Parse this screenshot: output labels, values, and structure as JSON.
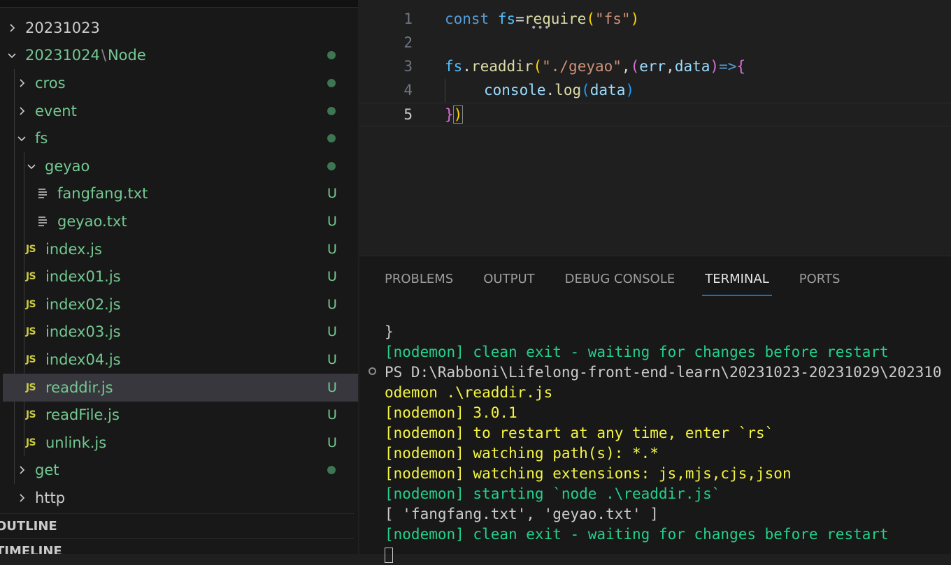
{
  "explorer": {
    "items": [
      {
        "label": "20231023",
        "status": ""
      },
      {
        "label": "20231024",
        "label_suffix": "Node",
        "status": "dot"
      },
      {
        "label": "cros",
        "status": "dot"
      },
      {
        "label": "event",
        "status": "dot"
      },
      {
        "label": "fs",
        "status": "dot"
      },
      {
        "label": "geyao",
        "status": "dot"
      },
      {
        "label": "fangfang.txt",
        "status": "U"
      },
      {
        "label": "geyao.txt",
        "status": "U"
      },
      {
        "label": "index.js",
        "status": "U"
      },
      {
        "label": "index01.js",
        "status": "U"
      },
      {
        "label": "index02.js",
        "status": "U"
      },
      {
        "label": "index03.js",
        "status": "U"
      },
      {
        "label": "index04.js",
        "status": "U"
      },
      {
        "label": "readdir.js",
        "status": "U"
      },
      {
        "label": "readFile.js",
        "status": "U"
      },
      {
        "label": "unlink.js",
        "status": "U"
      },
      {
        "label": "get",
        "status": "dot"
      },
      {
        "label": "http",
        "status": ""
      }
    ],
    "path_separator": "\\",
    "js_badge": "JS",
    "sections": {
      "outline": "OUTLINE",
      "timeline": "TIMELINE"
    }
  },
  "editor": {
    "line_numbers": [
      "1",
      "2",
      "3",
      "4",
      "5"
    ],
    "lines": {
      "l1": {
        "a": "const",
        "b": "fs",
        "c": "=",
        "d": "require",
        "e": "(",
        "f": "\"fs\"",
        "g": ")"
      },
      "l3": {
        "a": "fs",
        "b": ".",
        "c": "readdir",
        "d": "(",
        "e": "\"./geyao\"",
        "f": ",",
        "g": "(",
        "h": "err",
        "i": ",",
        "j": "data",
        "k": ")",
        "l": "=>",
        "m": "{"
      },
      "l4": {
        "a": "console",
        "b": ".",
        "c": "log",
        "d": "(",
        "e": "data",
        "f": ")"
      },
      "l5": {
        "a": "}",
        "b": ")"
      }
    }
  },
  "panel": {
    "tabs": [
      "PROBLEMS",
      "OUTPUT",
      "DEBUG CONSOLE",
      "TERMINAL",
      "PORTS"
    ],
    "active_tab": "TERMINAL",
    "terminal_lines": [
      "}",
      "[nodemon] clean exit - waiting for changes before restart",
      "PS D:\\Rabboni\\Lifelong-front-end-learn\\20231023-20231029\\202310",
      "odemon .\\readdir.js",
      "[nodemon] 3.0.1",
      "[nodemon] to restart at any time, enter `rs`",
      "[nodemon] watching path(s): *.*",
      "[nodemon] watching extensions: js,mjs,cjs,json",
      "[nodemon] starting `node .\\readdir.js`",
      "[ 'fangfang.txt', 'geyao.txt' ]",
      "[nodemon] clean exit - waiting for changes before restart"
    ]
  },
  "colors": {
    "git_untracked": "#73c991",
    "js_icon": "#cbcb41",
    "accent": "#0078d4",
    "terminal_green": "#23d18b",
    "terminal_yellow": "#f5f543"
  }
}
